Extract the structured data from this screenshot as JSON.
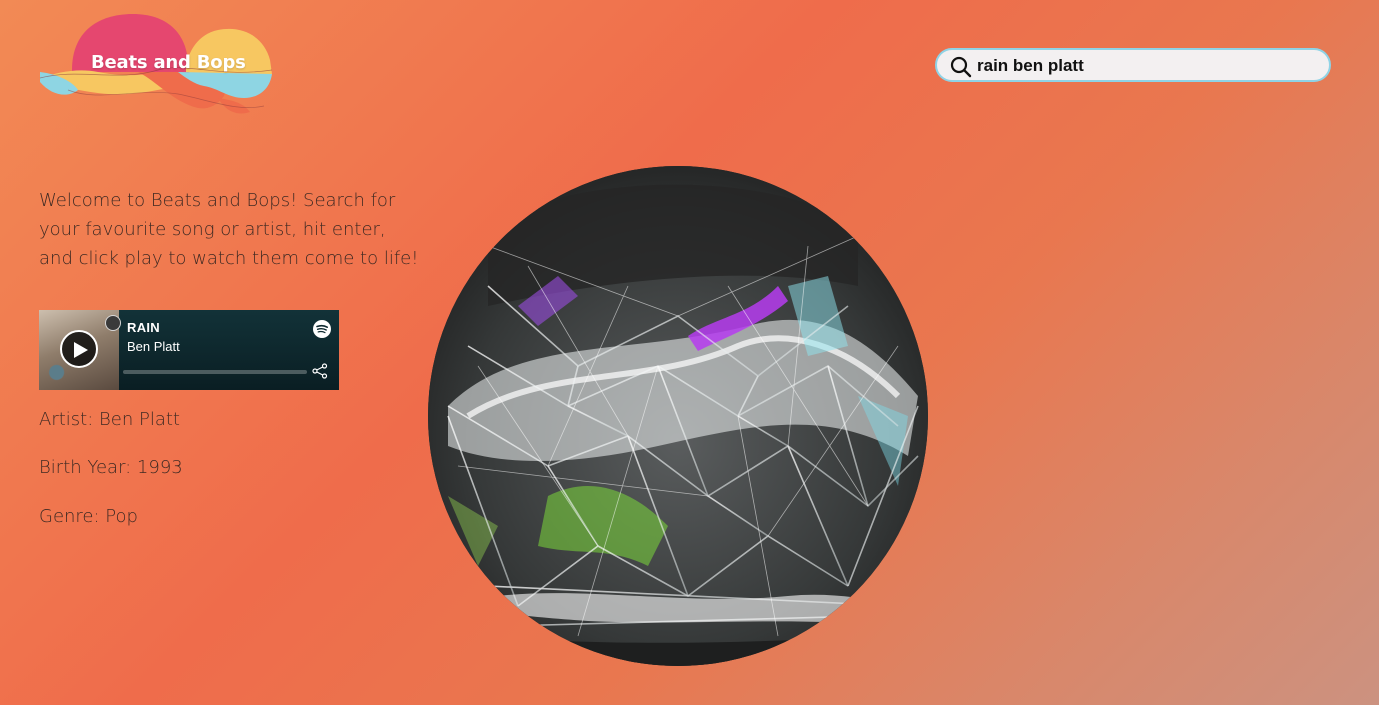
{
  "logo": {
    "text": "Beats and Bops"
  },
  "search": {
    "value": "rain ben platt",
    "icon": "search-icon"
  },
  "welcome": {
    "text": "Welcome to Beats and Bops! Search for your favourite song or artist, hit enter, and click play to watch them come to life!"
  },
  "player": {
    "title": "RAIN",
    "artist": "Ben Platt",
    "progress": 0,
    "icons": {
      "play": "play-icon",
      "brand": "spotify-icon",
      "share": "share-icon"
    }
  },
  "info": {
    "artist": "Artist: Ben Platt",
    "birth_year": "Birth Year: 1993",
    "genre": "Genre: Pop"
  },
  "colors": {
    "background_start": "#f28a55",
    "background_end": "#cc9280",
    "search_border": "#8fd3e6",
    "player_bg": "#0f2a30",
    "logo_pink": "#e5476f",
    "logo_yellow": "#f7c761",
    "logo_blue": "#8ed5e3"
  }
}
